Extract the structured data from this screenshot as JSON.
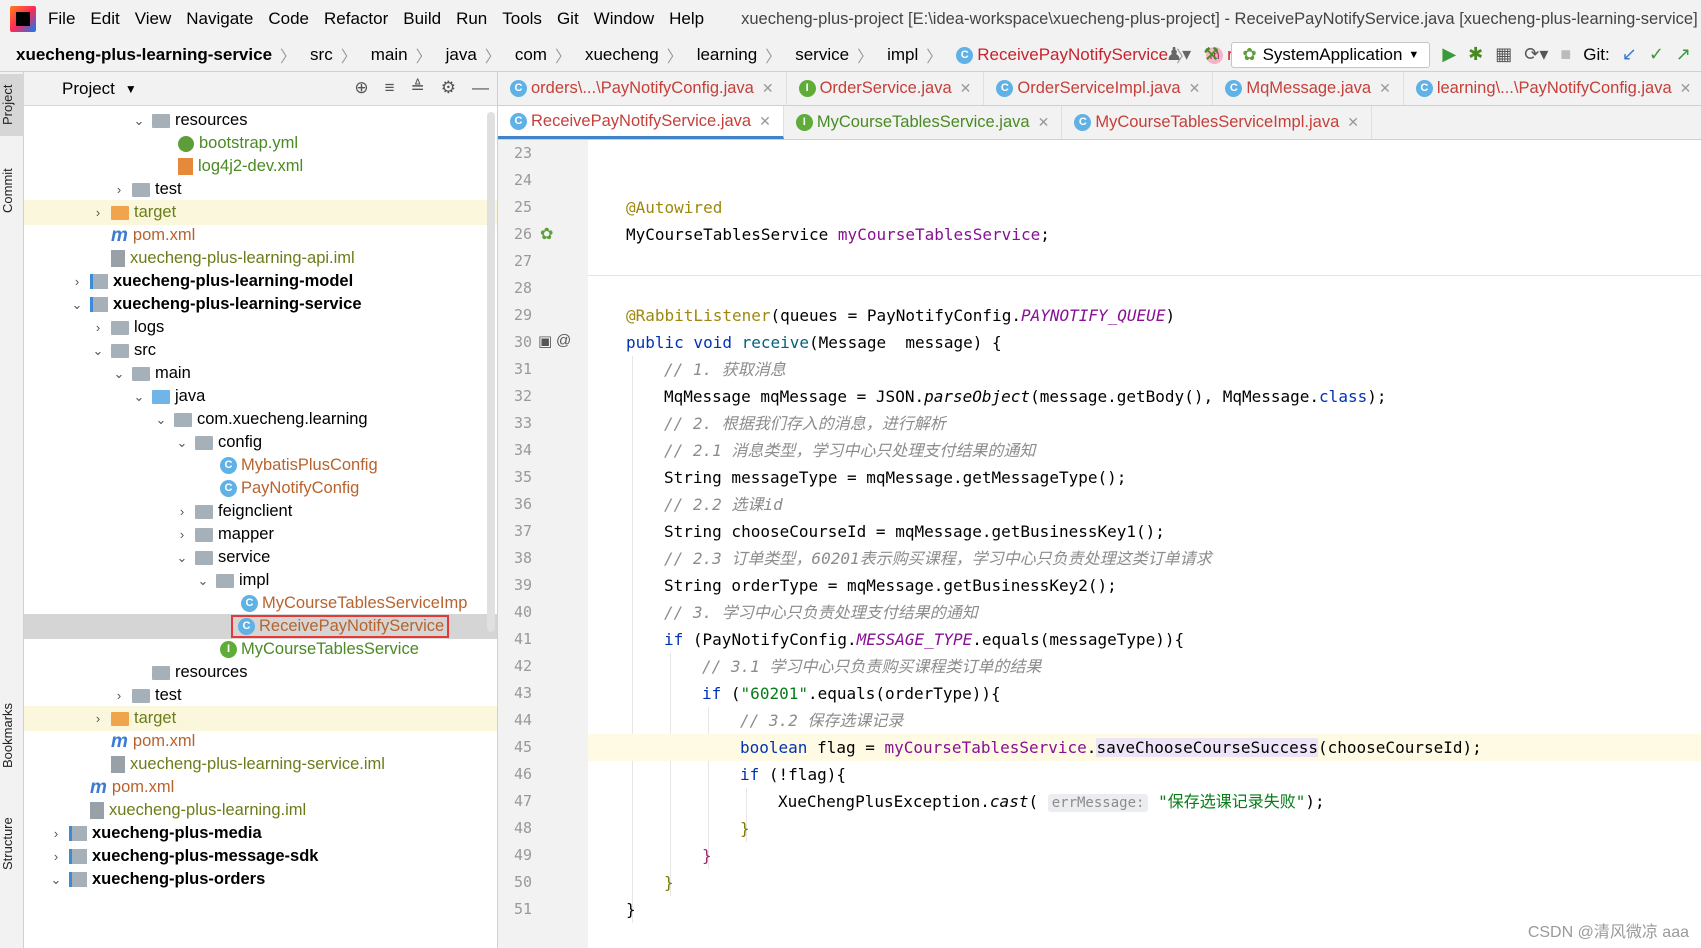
{
  "menubar": {
    "items": [
      "File",
      "Edit",
      "View",
      "Navigate",
      "Code",
      "Refactor",
      "Build",
      "Run",
      "Tools",
      "Git",
      "Window",
      "Help"
    ],
    "window_title": "xuecheng-plus-project [E:\\idea-workspace\\xuecheng-plus-project] - ReceivePayNotifyService.java [xuecheng-plus-learning-service]"
  },
  "breadcrumb": {
    "items": [
      "xuecheng-plus-learning-service",
      "src",
      "main",
      "java",
      "com",
      "xuecheng",
      "learning",
      "service",
      "impl",
      "ReceivePayNotifyService",
      "receive"
    ]
  },
  "toolbar": {
    "run_config": "SystemApplication",
    "git_label": "Git:"
  },
  "sidebar_tabs": {
    "project": "Project",
    "commit": "Commit",
    "bookmarks": "Bookmarks",
    "structure": "Structure"
  },
  "project_panel": {
    "title": "Project",
    "tree": [
      {
        "label": "resources"
      },
      {
        "label": "bootstrap.yml"
      },
      {
        "label": "log4j2-dev.xml"
      },
      {
        "label": "test"
      },
      {
        "label": "target"
      },
      {
        "label": "pom.xml"
      },
      {
        "label": "xuecheng-plus-learning-api.iml"
      },
      {
        "label": "xuecheng-plus-learning-model"
      },
      {
        "label": "xuecheng-plus-learning-service"
      },
      {
        "label": "logs"
      },
      {
        "label": "src"
      },
      {
        "label": "main"
      },
      {
        "label": "java"
      },
      {
        "label": "com.xuecheng.learning"
      },
      {
        "label": "config"
      },
      {
        "label": "MybatisPlusConfig"
      },
      {
        "label": "PayNotifyConfig"
      },
      {
        "label": "feignclient"
      },
      {
        "label": "mapper"
      },
      {
        "label": "service"
      },
      {
        "label": "impl"
      },
      {
        "label": "MyCourseTablesServiceImp"
      },
      {
        "label": "ReceivePayNotifyService"
      },
      {
        "label": "MyCourseTablesService"
      },
      {
        "label": "resources"
      },
      {
        "label": "test"
      },
      {
        "label": "target"
      },
      {
        "label": "pom.xml"
      },
      {
        "label": "xuecheng-plus-learning-service.iml"
      },
      {
        "label": "pom.xml"
      },
      {
        "label": "xuecheng-plus-learning.iml"
      },
      {
        "label": "xuecheng-plus-media"
      },
      {
        "label": "xuecheng-plus-message-sdk"
      },
      {
        "label": "xuecheng-plus-orders"
      }
    ]
  },
  "editor_tabs": {
    "row1": [
      "orders\\...\\PayNotifyConfig.java",
      "OrderService.java",
      "OrderServiceImpl.java",
      "MqMessage.java",
      "learning\\...\\PayNotifyConfig.java"
    ],
    "row2": [
      "ReceivePayNotifyService.java",
      "MyCourseTablesService.java",
      "MyCourseTablesServiceImpl.java"
    ]
  },
  "code": {
    "line_numbers": [
      "23",
      "24",
      "25",
      "26",
      "27",
      "28",
      "29",
      "30",
      "31",
      "32",
      "33",
      "34",
      "35",
      "36",
      "37",
      "38",
      "39",
      "40",
      "41",
      "42",
      "43",
      "44",
      "45",
      "46",
      "47",
      "48",
      "49",
      "50",
      "51"
    ],
    "t": {
      "autowired": "@Autowired",
      "l26a": "MyCourseTablesService ",
      "l26b": "myCourseTablesService",
      "l26c": ";",
      "l29a": "@RabbitListener",
      "l29b": "(queues = PayNotifyConfig.",
      "l29c": "PAYNOTIFY_QUEUE",
      "l29d": ")",
      "l30a": "public void ",
      "l30b": "receive",
      "l30c": "(Message  message) {",
      "l31": "// 1. 获取消息",
      "l32a": "MqMessage mqMessage = JSON.",
      "l32b": "parseObject",
      "l32c": "(message.getBody(), MqMessage.",
      "l32d": "class",
      "l32e": ");",
      "l33": "// 2. 根据我们存入的消息，进行解析",
      "l34": "// 2.1 消息类型，学习中心只处理支付结果的通知",
      "l35": "String messageType = mqMessage.getMessageType();",
      "l36": "// 2.2 选课id",
      "l37": "String chooseCourseId = mqMessage.getBusinessKey1();",
      "l38": "// 2.3 订单类型，60201表示购买课程，学习中心只负责处理这类订单请求",
      "l39": "String orderType = mqMessage.getBusinessKey2();",
      "l40": "// 3. 学习中心只负责处理支付结果的通知",
      "l41a": "if ",
      "l41b": "(PayNotifyConfig.",
      "l41c": "MESSAGE_TYPE",
      "l41d": ".equals(messageType)){",
      "l42": "// 3.1 学习中心只负责购买课程类订单的结果",
      "l43a": "if ",
      "l43b": "(",
      "l43c": "\"60201\"",
      "l43d": ".equals(orderType)){",
      "l44": "// 3.2 保存选课记录",
      "l45a": "boolean ",
      "l45b": "flag = ",
      "l45c": "myCourseTablesService",
      "l45d": ".",
      "l45e": "saveChooseCourseSuccess",
      "l45f": "(chooseCourseId);",
      "l46a": "if ",
      "l46b": "(!flag){",
      "l47a": "XueChengPlusException.",
      "l47b": "cast",
      "l47c": "( ",
      "l47hint": "errMessage:",
      "l47d": " ",
      "l47e": "\"保存选课记录失败\"",
      "l47f": ");",
      "close": "}"
    }
  },
  "watermark": "CSDN @清风微凉 aaa"
}
